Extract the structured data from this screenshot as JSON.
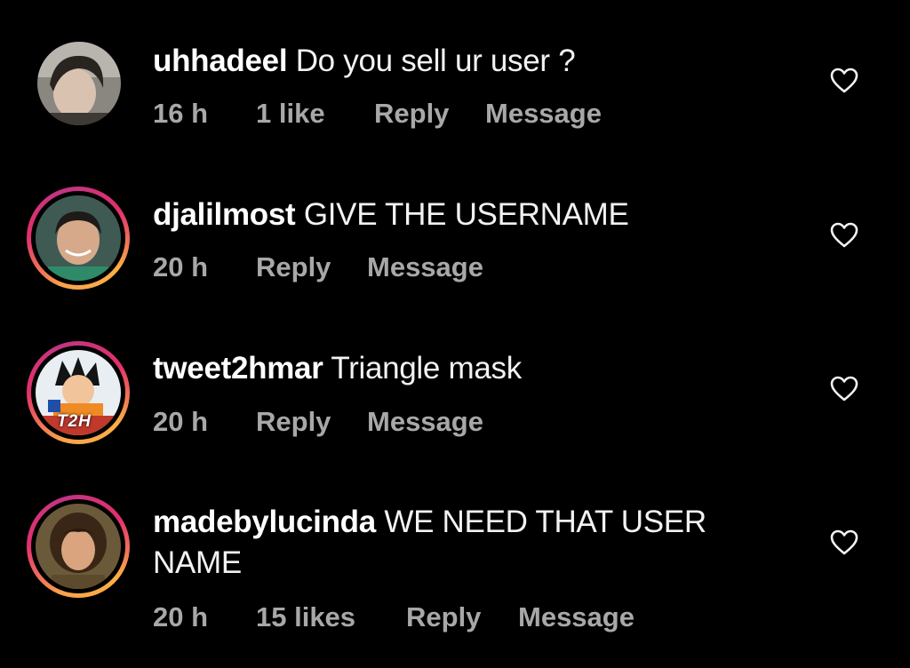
{
  "comments": [
    {
      "username": "uhhadeel",
      "text": "Do you sell ur user ?",
      "time": "16 h",
      "likes": "1 like",
      "reply": "Reply",
      "message": "Message",
      "has_story_ring": false
    },
    {
      "username": "djalilmost",
      "text": "GIVE THE USERNAME",
      "time": "20 h",
      "likes": "",
      "reply": "Reply",
      "message": "Message",
      "has_story_ring": true
    },
    {
      "username": "tweet2hmar",
      "text": "Triangle mask",
      "time": "20 h",
      "likes": "",
      "reply": "Reply",
      "message": "Message",
      "has_story_ring": true,
      "avatar_badge": "T2H"
    },
    {
      "username": "madebylucinda",
      "text_line1": "WE NEED THAT USER",
      "text_line2": "NAME",
      "time": "20 h",
      "likes": "15 likes",
      "reply": "Reply",
      "message": "Message",
      "has_story_ring": true
    }
  ],
  "icons": {
    "like": "heart-outline-icon"
  },
  "colors": {
    "background": "#000000",
    "primary_text": "#ffffff",
    "secondary_text": "#a8a8a8",
    "story_ring_start": "#f9a24a",
    "story_ring_end": "#c13584"
  }
}
